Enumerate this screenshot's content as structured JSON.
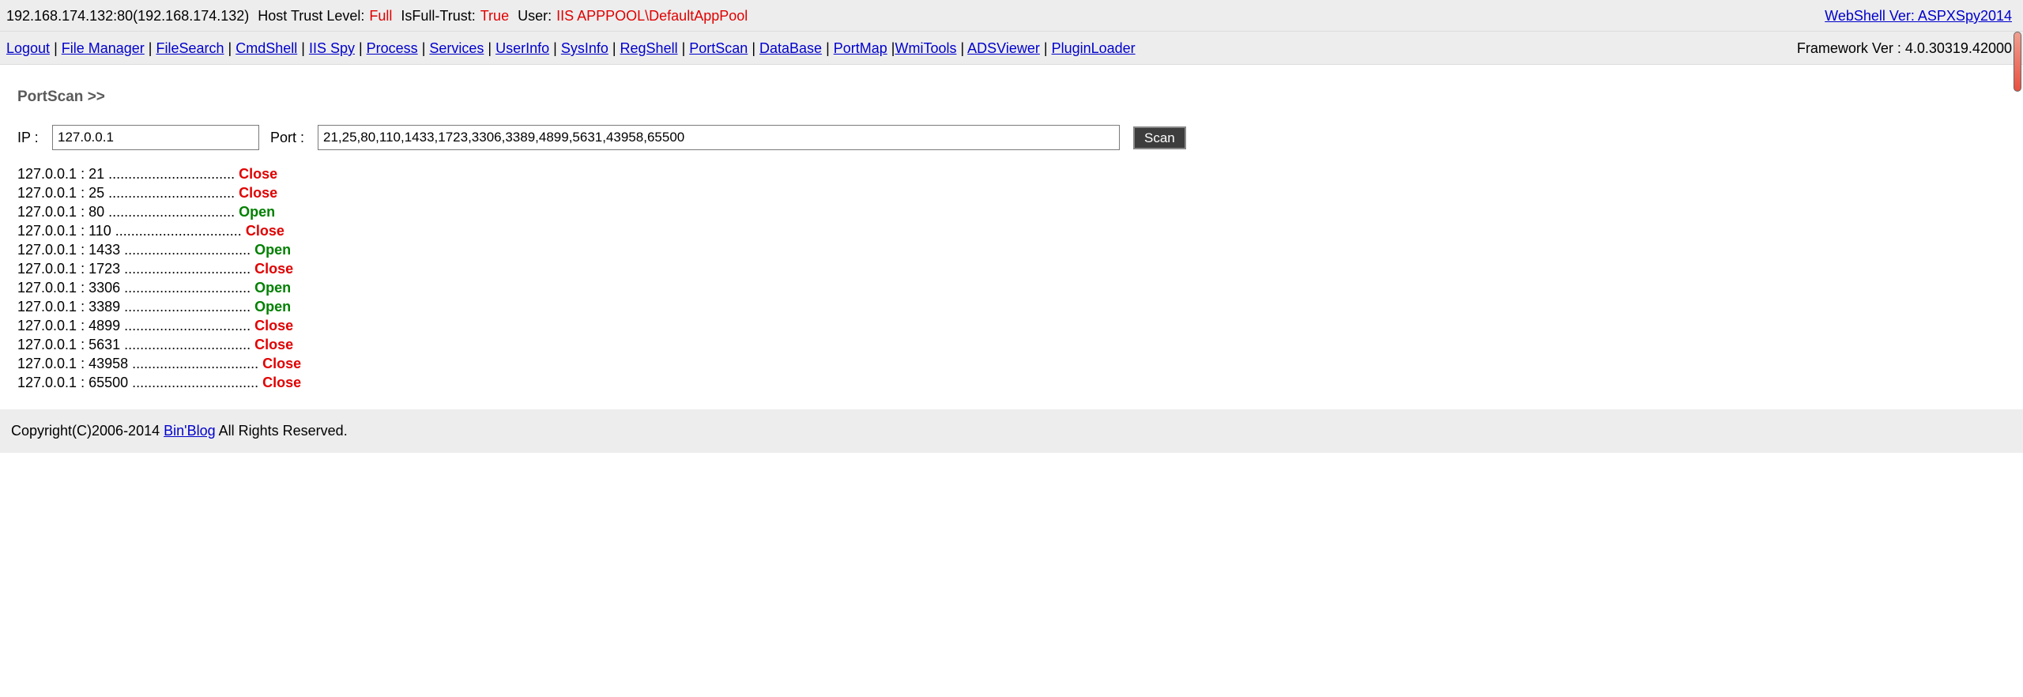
{
  "header": {
    "host": "192.168.174.132:80(192.168.174.132)",
    "trust_label": "Host Trust Level:",
    "trust_value": "Full",
    "fulltrust_label": "IsFull-Trust:",
    "fulltrust_value": "True",
    "user_label": "User:",
    "user_value": "IIS APPPOOL\\DefaultAppPool",
    "version_link": "WebShell Ver: ASPXSpy2014"
  },
  "nav": {
    "items": [
      "Logout",
      "File Manager",
      "FileSearch",
      "CmdShell",
      "IIS Spy",
      "Process",
      "Services",
      "UserInfo",
      "SysInfo",
      "RegShell",
      "PortScan",
      "DataBase",
      "PortMap",
      "WmiTools",
      "ADSViewer",
      "PluginLoader"
    ],
    "framework": "Framework Ver : 4.0.30319.42000"
  },
  "page": {
    "title": "PortScan >>",
    "ip_label": "IP :",
    "ip_value": "127.0.0.1",
    "port_label": "Port :",
    "port_value": "21,25,80,110,1433,1723,3306,3389,4899,5631,43958,65500",
    "scan_button": "Scan"
  },
  "results": [
    {
      "prefix": "127.0.0.1 : 21 ................................",
      "status": "Close",
      "open": false
    },
    {
      "prefix": "127.0.0.1 : 25 ................................",
      "status": "Close",
      "open": false
    },
    {
      "prefix": "127.0.0.1 : 80 ................................",
      "status": "Open",
      "open": true
    },
    {
      "prefix": "127.0.0.1 : 110 ................................",
      "status": "Close",
      "open": false
    },
    {
      "prefix": "127.0.0.1 : 1433 ................................",
      "status": "Open",
      "open": true
    },
    {
      "prefix": "127.0.0.1 : 1723 ................................",
      "status": "Close",
      "open": false
    },
    {
      "prefix": "127.0.0.1 : 3306 ................................",
      "status": "Open",
      "open": true
    },
    {
      "prefix": "127.0.0.1 : 3389 ................................",
      "status": "Open",
      "open": true
    },
    {
      "prefix": "127.0.0.1 : 4899 ................................",
      "status": "Close",
      "open": false
    },
    {
      "prefix": "127.0.0.1 : 5631 ................................",
      "status": "Close",
      "open": false
    },
    {
      "prefix": "127.0.0.1 : 43958 ................................",
      "status": "Close",
      "open": false
    },
    {
      "prefix": "127.0.0.1 : 65500 ................................",
      "status": "Close",
      "open": false
    }
  ],
  "footer": {
    "prefix": "Copyright(C)2006-2014",
    "link": "Bin'Blog",
    "suffix": "All Rights Reserved."
  },
  "colors": {
    "open": "#008000",
    "close": "#e00000",
    "bar_bg": "#ededed"
  }
}
